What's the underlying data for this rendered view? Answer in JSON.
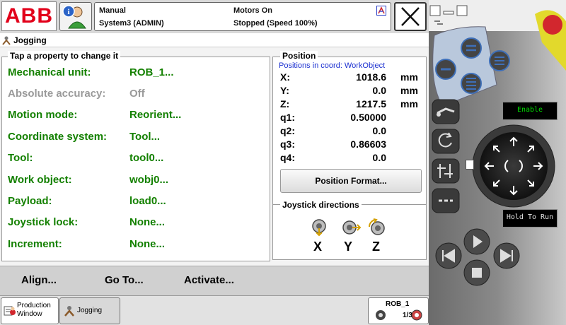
{
  "header": {
    "logo_text": "ABB",
    "mode": "Manual",
    "system": "System3 (ADMIN)",
    "motors": "Motors On",
    "state": "Stopped (Speed 100%)"
  },
  "window": {
    "title": "Jogging"
  },
  "properties": {
    "group_label": "Tap a property to change it",
    "rows": [
      {
        "label": "Mechanical unit:",
        "value": "ROB_1..."
      },
      {
        "label": "Absolute accuracy:",
        "value": "Off"
      },
      {
        "label": "Motion mode:",
        "value": "Reorient..."
      },
      {
        "label": "Coordinate system:",
        "value": "Tool..."
      },
      {
        "label": "Tool:",
        "value": "tool0..."
      },
      {
        "label": "Work object:",
        "value": "wobj0..."
      },
      {
        "label": "Payload:",
        "value": "load0..."
      },
      {
        "label": "Joystick lock:",
        "value": "None..."
      },
      {
        "label": "Increment:",
        "value": "None..."
      }
    ]
  },
  "position": {
    "group_label": "Position",
    "coord_label": "Positions in coord: WorkObject",
    "rows": [
      {
        "label": "X:",
        "value": "1018.6",
        "unit": "mm"
      },
      {
        "label": "Y:",
        "value": "0.0",
        "unit": "mm"
      },
      {
        "label": "Z:",
        "value": "1217.5",
        "unit": "mm"
      },
      {
        "label": "q1:",
        "value": "0.50000",
        "unit": ""
      },
      {
        "label": "q2:",
        "value": "0.0",
        "unit": ""
      },
      {
        "label": "q3:",
        "value": "0.86603",
        "unit": ""
      },
      {
        "label": "q4:",
        "value": "0.0",
        "unit": ""
      }
    ],
    "format_button": "Position Format..."
  },
  "joystick": {
    "group_label": "Joystick directions",
    "axes": [
      "X",
      "Y",
      "Z"
    ]
  },
  "actions": {
    "align": "Align...",
    "goto": "Go To...",
    "activate": "Activate..."
  },
  "taskbar": {
    "production_window_line1": "Production",
    "production_window_line2": "Window",
    "jogging": "Jogging",
    "mech_unit": "ROB_1",
    "mech_unit_fraction": "1/3"
  },
  "pendant": {
    "enable_label": "Enable",
    "hold_label": "Hold To Run",
    "lcd_color": "#00dd00",
    "accent_yellow": "#e2d92c",
    "estop_red": "#d2272e",
    "button_blue": "#3e6fb8"
  }
}
